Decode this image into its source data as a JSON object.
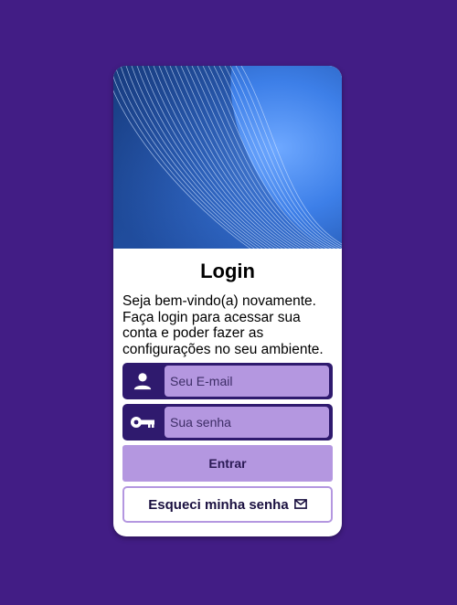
{
  "login": {
    "title": "Login",
    "description": "Seja bem-vindo(a) novamente. Faça login para acessar sua conta e poder fazer as configurações no seu ambiente.",
    "email": {
      "placeholder": "Seu E-mail",
      "value": "",
      "icon": "user-icon"
    },
    "password": {
      "placeholder": "Sua senha",
      "value": "",
      "icon": "key-icon"
    },
    "submit_label": "Entrar",
    "forgot_label": "Esqueci minha senha",
    "forgot_icon": "mail-icon"
  },
  "colors": {
    "background": "#421d85",
    "card": "#ffffff",
    "field_dark": "#2f1a6e",
    "field_light": "#b497e0",
    "hero_blue": "#3a7bf0"
  }
}
